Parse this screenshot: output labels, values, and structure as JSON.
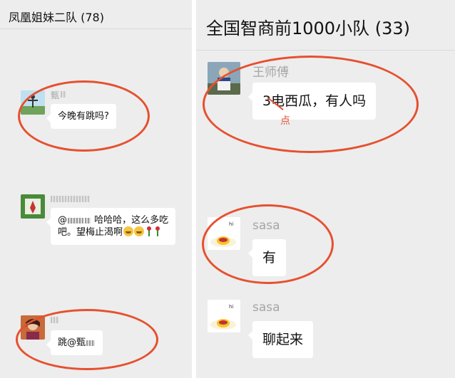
{
  "left_chat": {
    "title": "凤凰姐妹二队 (78)",
    "messages": [
      {
        "sender": "甄",
        "text": "今晚有跳吗?"
      },
      {
        "mention": "@",
        "text": "哈哈哈，这么多吃",
        "text_line2": "吧。望梅止渴啊"
      },
      {
        "text": "跳@甄"
      }
    ]
  },
  "right_chat": {
    "title": "全国智商前1000小队 (33)",
    "messages": [
      {
        "sender": "王师傅",
        "text": "3电西瓜，有人吗",
        "correction": "点"
      },
      {
        "sender": "sasa",
        "text": "有"
      },
      {
        "sender": "sasa",
        "text": "聊起来"
      }
    ]
  },
  "colors": {
    "annotation": "#e6502f",
    "chat_background": "#ededed",
    "bubble": "#ffffff",
    "sender_name": "#a5a5a5"
  }
}
